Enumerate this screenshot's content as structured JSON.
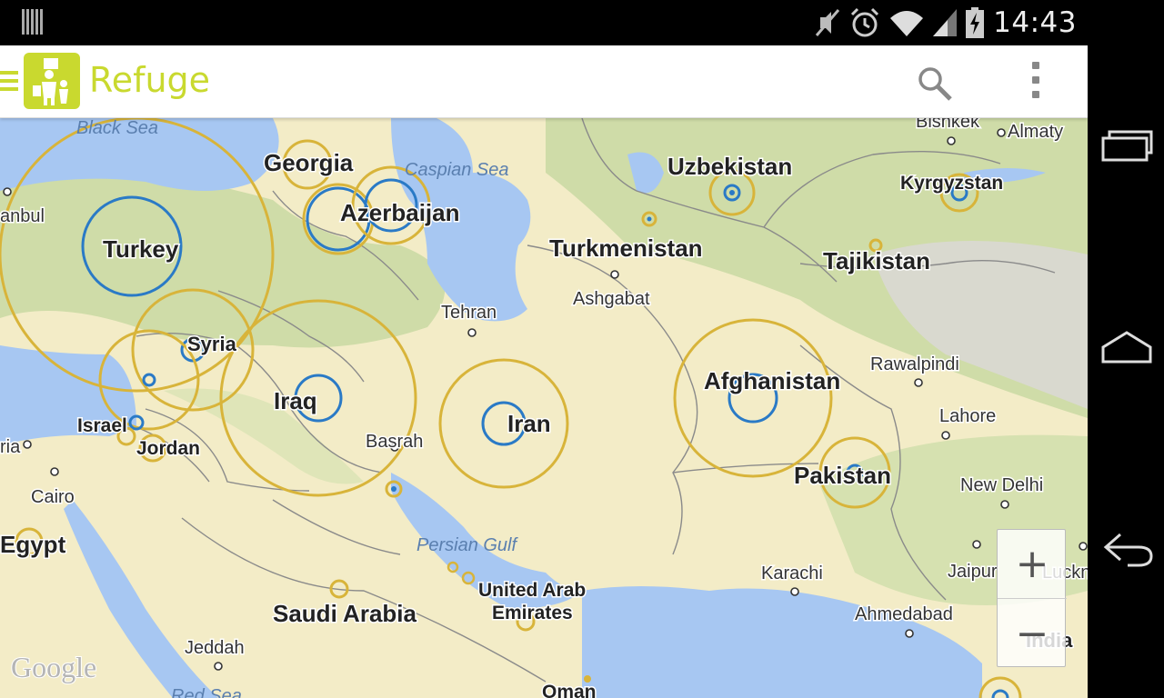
{
  "status_bar": {
    "time": "14:43",
    "icons": [
      "barcode-icon",
      "mute-icon",
      "alarm-icon",
      "wifi-icon",
      "signal-icon",
      "battery-charging-icon"
    ]
  },
  "app_bar": {
    "title": "Refuge",
    "icons": [
      "drawer-menu-icon",
      "app-logo-icon",
      "search-icon",
      "overflow-menu-icon"
    ],
    "accent_color": "#c9d92f"
  },
  "map": {
    "attribution": "Google",
    "seas": [
      "Black Sea",
      "Caspian Sea",
      "Persian Gulf",
      "Red Sea"
    ],
    "countries": [
      "Georgia",
      "Azerbaijan",
      "Uzbekistan",
      "Kyrgyzstan",
      "Turkey",
      "Turkmenistan",
      "Tajikistan",
      "Syria",
      "Afghanistan",
      "Iraq",
      "Iran",
      "Israel",
      "Jordan",
      "Pakistan",
      "Egypt",
      "Saudi Arabia",
      "United Arab",
      "Emirates",
      "Oman",
      "India"
    ],
    "cities": [
      "Bishkek",
      "Almaty",
      "anbul",
      "Tehran",
      "Ashgabat",
      "Rawalpindi",
      "Lahore",
      "Basrah",
      "ria",
      "Cairo",
      "New Delhi",
      "Jaipur",
      "Luckn",
      "Karachi",
      "Ahmedabad",
      "Jeddah"
    ],
    "circle_colors": {
      "outer": "#d8b43a",
      "inner": "#2a7ac6"
    }
  },
  "zoom": {
    "in_label": "+",
    "out_label": "−"
  },
  "nav_bar": {
    "icons": [
      "recent-apps-icon",
      "home-icon",
      "back-icon"
    ]
  }
}
